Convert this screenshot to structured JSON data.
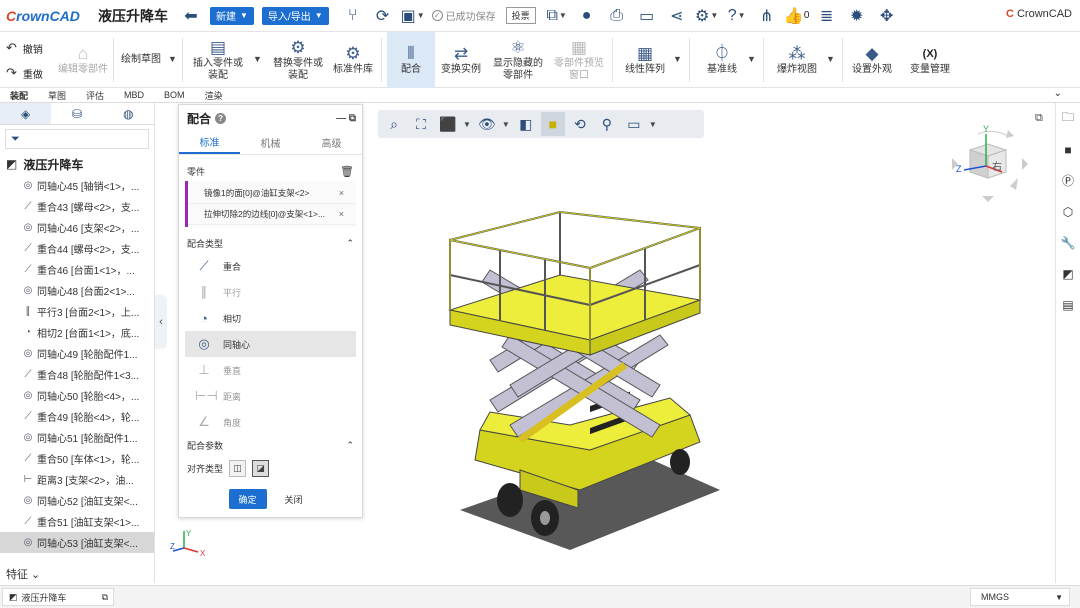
{
  "app": {
    "logo_a": "C",
    "logo_b": "rownCAD",
    "doc_title": "液压升降车",
    "new_label": "新建",
    "import_export_label": "导入/导出",
    "saved_label": "已成功保存",
    "feedback_label": "投票",
    "like_count": "0",
    "brand": "CrownCAD"
  },
  "ribbon": {
    "undo": "撤销",
    "redo": "重做",
    "edit_part": "编辑零部件",
    "sketch": "绘制草图",
    "insert_line1": "插入零件或",
    "insert_line2": "装配",
    "replace_line1": "替换零件或",
    "replace_line2": "装配",
    "std_lib": "标准件库",
    "mate": "配合",
    "transform": "变换实例",
    "show_hidden_line1": "显示隐藏的",
    "show_hidden_line2": "零部件",
    "preview_line1": "零部件预览",
    "preview_line2": "窗口",
    "linear_pattern": "线性阵列",
    "datum_line": "基准线",
    "exploded": "爆炸视图",
    "appearance": "设置外观",
    "variables": "变量管理",
    "variables_icon": "(X)"
  },
  "tabs": [
    "装配",
    "草图",
    "评估",
    "MBD",
    "BOM",
    "渲染"
  ],
  "tree": {
    "root": "液压升降车",
    "items": [
      {
        "type": "concentric",
        "label": "同轴心45 [轴销<1>，..."
      },
      {
        "type": "coincident",
        "label": "重合43 [螺母<2>，支..."
      },
      {
        "type": "concentric",
        "label": "同轴心46 [支架<2>，..."
      },
      {
        "type": "coincident",
        "label": "重合44 [螺母<2>，支..."
      },
      {
        "type": "coincident",
        "label": "重合46 [台面1<1>，..."
      },
      {
        "type": "concentric",
        "label": "同轴心48 [台面2<1>..."
      },
      {
        "type": "parallel",
        "label": "平行3 [台面2<1>，上..."
      },
      {
        "type": "tangent",
        "label": "相切2 [台面1<1>，底..."
      },
      {
        "type": "concentric",
        "label": "同轴心49 [轮胎配件1..."
      },
      {
        "type": "coincident",
        "label": "重合48 [轮胎配件1<3..."
      },
      {
        "type": "concentric",
        "label": "同轴心50 [轮胎<4>，..."
      },
      {
        "type": "coincident",
        "label": "重合49 [轮胎<4>，轮..."
      },
      {
        "type": "concentric",
        "label": "同轴心51 [轮胎配件1..."
      },
      {
        "type": "coincident",
        "label": "重合50 [车体<1>，轮..."
      },
      {
        "type": "distance",
        "label": "距离3 [支架<2>，油..."
      },
      {
        "type": "concentric",
        "label": "同轴心52 [油缸支架<..."
      },
      {
        "type": "coincident",
        "label": "重合51 [油缸支架<1>..."
      },
      {
        "type": "concentric",
        "label": "同轴心53 [油缸支架<..."
      }
    ],
    "feature_label": "特征"
  },
  "mate_panel": {
    "title": "配合",
    "tabs": [
      "标准",
      "机械",
      "高级"
    ],
    "parts_label": "零件",
    "parts": [
      "镜像1的面[0]@油缸支架<2>",
      "拉伸切除2的边线[0]@支架<1>..."
    ],
    "types_label": "配合类型",
    "types": [
      {
        "label": "重合",
        "icon": "coincident-icon"
      },
      {
        "label": "平行",
        "icon": "parallel-icon"
      },
      {
        "label": "相切",
        "icon": "tangent-icon"
      },
      {
        "label": "同轴心",
        "icon": "concentric-icon"
      },
      {
        "label": "垂直",
        "icon": "perpendicular-icon"
      },
      {
        "label": "距离",
        "icon": "distance-icon"
      },
      {
        "label": "角度",
        "icon": "angle-icon"
      }
    ],
    "params_label": "配合参数",
    "align_label": "对齐类型",
    "ok": "确定",
    "close": "关闭"
  },
  "viewcube": {
    "axis_y": "Y",
    "axis_z": "Z",
    "face": "右"
  },
  "triad": {
    "y": "Y",
    "z": "Z",
    "x": "X"
  },
  "statusbar": {
    "doc_tab": "液压升降车",
    "units": "MMGS"
  },
  "colors": {
    "accent": "#1c6fd1",
    "model_yellow": "#e6e62a",
    "scissor": "#b9b6cc"
  }
}
